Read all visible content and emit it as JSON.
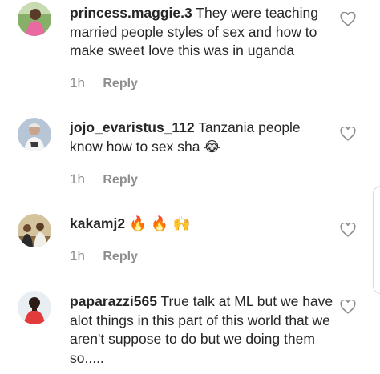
{
  "comments": [
    {
      "username": "princess.maggie.3",
      "text": "They were teaching married people styles of sex and how to make sweet love this was in uganda",
      "time": "1h",
      "reply_label": "Reply",
      "avatar_icon": "avatar-photo-pink-outfit",
      "avatar_colors": [
        "#7aa85c",
        "#e86aa0",
        "#3b2a22"
      ]
    },
    {
      "username": "jojo_evaristus_112",
      "text": "Tanzania people know how to sex sha 😂",
      "time": "1h",
      "reply_label": "Reply",
      "avatar_icon": "avatar-photo-white-shirt",
      "avatar_colors": [
        "#b7c6d6",
        "#f2f2f2",
        "#3a3a3a"
      ]
    },
    {
      "username": "kakamj2",
      "text": "🔥 🔥 🙌",
      "time": "1h",
      "reply_label": "Reply",
      "avatar_icon": "avatar-photo-group",
      "avatar_colors": [
        "#c9b38a",
        "#6b4a2e",
        "#2a2a2a"
      ]
    },
    {
      "username": "paparazzi565",
      "text": "True talk at ML but we have alot things in this part of this world that we aren't suppose to do but we doing them so.....",
      "time": "",
      "reply_label": "",
      "avatar_icon": "avatar-photo-red-shirt",
      "avatar_colors": [
        "#e9eef2",
        "#e23b3b",
        "#2b1d16"
      ]
    }
  ],
  "like_icon": "heart-outline-icon",
  "colors": {
    "text": "#262626",
    "secondary": "#8e8e8e"
  }
}
